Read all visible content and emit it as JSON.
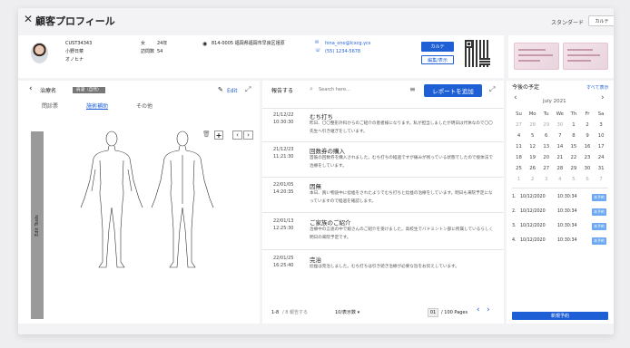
{
  "app": {
    "title": "顧客プロフィール",
    "mode_label": "スタンダード",
    "mode_tab": "カルテ"
  },
  "patient": {
    "id": "CUST34343",
    "name": "小野日菜",
    "name_kana": "オノヒナ",
    "gender": "女",
    "age": "24年",
    "visits_label": "訪問数",
    "visits": "54",
    "address": "814-0005 福岡県福岡市早良区祖原",
    "email": "hina_ono@lcxcg.ycs",
    "phone": "(55) 1234-5678",
    "btn_karte": "カルテ",
    "btn_edit": "編集/表示"
  },
  "left": {
    "back": "‹",
    "label": "治療名",
    "chip": "肩凝（自然）",
    "edit": "Edit",
    "tabs": [
      "問診票",
      "施術補助",
      "その他"
    ],
    "edit_tools": "Edit Tools"
  },
  "mid": {
    "header": "報告する",
    "search_placeholder": "Search here...",
    "add_btn": "レポートを追加",
    "entries": [
      {
        "date": "21/12/22",
        "time": "10:30:30",
        "title": "むち打ち",
        "body": "昨日、〇〇整形外科からのご紹介の患者様になります。私が担当しましたが明日は代休なので〇〇先生へ引き継ぎをしています。"
      },
      {
        "date": "21/12/23",
        "time": "11:21:30",
        "title": "回数券の購入",
        "body": "首筋の回数券を購入されました。むち打ちの経過ですが痛みが残っている状態でしたので接体法で治療をしています。"
      },
      {
        "date": "22/01/05",
        "time": "14:20:35",
        "title": "因無",
        "body": "本日、買い物途中に捻挫をされたようでむち打ちと捻挫の治療をしています。明日も来院予定になっていますので経過を確認します。"
      },
      {
        "date": "22/01/13",
        "time": "12:25:30",
        "title": "ご家族のご紹介",
        "body": "治療中の言語の中で娘さんのご紹介を受けました。高校生でバドミントン部に所属しているらしく明日の来院予定です。"
      },
      {
        "date": "22/01/25",
        "time": "16:25:40",
        "title": "完治",
        "body": "捻挫は完治しました。むち打ちは引き続き治療が必要な旨をお伝えしています。"
      }
    ],
    "footer_range": "1-8",
    "footer_total": "/ 8 報告する",
    "per_page": "10/表示数 ▾",
    "page": "01",
    "pages": "/ 100 Pages"
  },
  "right": {
    "title": "今後の予定",
    "all": "すべて表示",
    "month": "July 2021",
    "days": [
      "Su",
      "Mo",
      "Tu",
      "We",
      "Th",
      "Fr",
      "Sa"
    ],
    "weeks": [
      [
        "27",
        "28",
        "29",
        "30",
        "1",
        "2",
        "3"
      ],
      [
        "4",
        "5",
        "6",
        "7",
        "8",
        "9",
        "10"
      ],
      [
        "11",
        "12",
        "13",
        "14",
        "15",
        "16",
        "17"
      ],
      [
        "18",
        "19",
        "20",
        "21",
        "22",
        "23",
        "24"
      ],
      [
        "25",
        "26",
        "27",
        "28",
        "29",
        "30",
        "31"
      ],
      [
        "1",
        "2",
        "3",
        "4",
        "5",
        "6",
        "7"
      ]
    ],
    "appts": [
      {
        "n": "1.",
        "date": "10/12/2020",
        "time": "10:30:34",
        "btn": "本予約"
      },
      {
        "n": "2.",
        "date": "10/12/2020",
        "time": "10:30:34",
        "btn": "本予約"
      },
      {
        "n": "3.",
        "date": "10/12/2020",
        "time": "10:30:34",
        "btn": "本予約"
      },
      {
        "n": "4.",
        "date": "10/12/2020",
        "time": "10:30:34",
        "btn": "本予約"
      }
    ],
    "new_btn": "新規予約"
  },
  "colors": {
    "accent": "#1f5fd6",
    "badge": "#6ea8f2"
  }
}
